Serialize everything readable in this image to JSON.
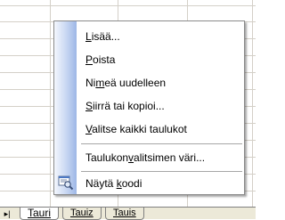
{
  "sheet_tabs": [
    {
      "label": "Tauri",
      "active": true
    },
    {
      "label": "Tauiz",
      "active": false
    },
    {
      "label": "Tauis",
      "active": false
    }
  ],
  "tab_nav_glyph": "▸|",
  "context_menu": {
    "items": [
      {
        "pre": "",
        "accel": "L",
        "post": "isää...",
        "icon": null
      },
      {
        "pre": "",
        "accel": "P",
        "post": "oista",
        "icon": null
      },
      {
        "pre": "Ni",
        "accel": "m",
        "post": "eä uudelleen",
        "icon": null
      },
      {
        "pre": "",
        "accel": "S",
        "post": "iirrä tai kopioi...",
        "icon": null
      },
      {
        "pre": "",
        "accel": "V",
        "post": "alitse kaikki taulukot",
        "icon": null
      },
      {
        "pre": "Taulukon",
        "accel": "v",
        "post": "alitsimen väri...",
        "icon": null
      },
      {
        "pre": "Näytä ",
        "accel": "k",
        "post": "oodi",
        "icon": "view-code-icon"
      }
    ]
  },
  "colors": {
    "menu_stripe": "#9db7e6",
    "grid_line": "#d4d0c8",
    "tab_bar": "#ece9d8"
  }
}
